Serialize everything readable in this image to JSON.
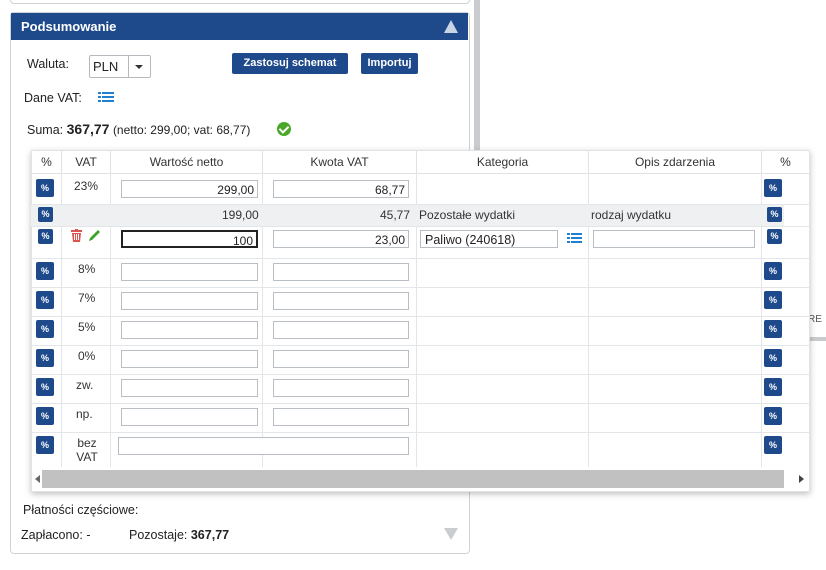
{
  "panel": {
    "title": "Podsumowanie"
  },
  "currency": {
    "label": "Waluta:",
    "value": "PLN"
  },
  "buttons": {
    "apply_scheme": "Zastosuj schemat",
    "import": "Importuj"
  },
  "vat_data": {
    "label": "Dane VAT:"
  },
  "sum": {
    "label": "Suma:",
    "value": "367,77",
    "detail": "(netto: 299,00; vat: 68,77)"
  },
  "table": {
    "headers": [
      "%",
      "VAT",
      "Wartość netto",
      "Kwota VAT",
      "Kategoria",
      "Opis zdarzenia",
      "%"
    ],
    "pct_label": "%",
    "row_23": {
      "vat": "23%",
      "netto": "299,00",
      "kwota": "68,77"
    },
    "sub_row": {
      "netto": "199,00",
      "kwota": "45,77",
      "kategoria": "Pozostałe wydatki",
      "opis": "rodzaj wydatku"
    },
    "edit_row": {
      "netto": "100",
      "kwota": "23,00",
      "kategoria": "Paliwo (240618)",
      "opis": ""
    },
    "rates": [
      "8%",
      "7%",
      "5%",
      "0%",
      "zw.",
      "np."
    ],
    "bez_vat": [
      "bez",
      "VAT"
    ]
  },
  "side_text": "RE",
  "payments": {
    "title": "Płatności częściowe:",
    "paid_label": "Zapłacono:",
    "paid_value": "-",
    "remaining_label": "Pozostaje:",
    "remaining_value": "367,77"
  },
  "colors": {
    "header_bg": "#1e4a8c",
    "success": "#4aa828",
    "delete": "#d9534f",
    "edit": "#3aa528",
    "list_icon": "#1f7fd1"
  }
}
